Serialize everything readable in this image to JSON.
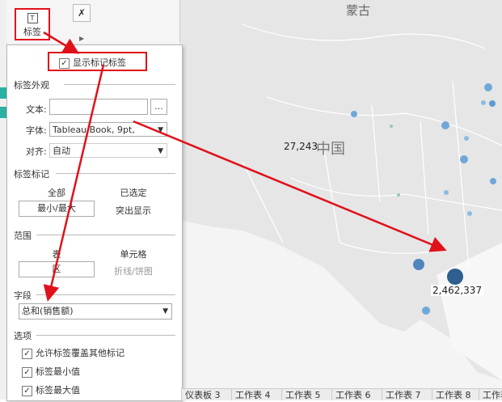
{
  "map": {
    "country_mongolia": "蒙古",
    "country_china": "中国",
    "value_china": "27,243",
    "value_guangdong": "2,462,337",
    "colors": {
      "land": "#e9e9e9",
      "border": "#ffffff",
      "water": "#fbfbfb",
      "dot_light": "#6fa8d8",
      "dot_dark": "#2e5f8e",
      "dot_mid": "#4f85bf",
      "dot_teal": "#8fc9c3"
    }
  },
  "toolbar": {
    "label_button_text": "标签",
    "label_button_icon": "T",
    "clear_icon": "clear-filter-icon"
  },
  "panel": {
    "show_labels": "显示标记标签",
    "appearance_section": "标签外观",
    "text_label": "文本:",
    "text_button": "...",
    "font_label": "字体:",
    "font_value": "Tableau Book,  9pt,",
    "align_label": "对齐:",
    "align_value": "自动",
    "marks_section": "标签标记",
    "marks_all": "全部",
    "marks_selected": "已选定",
    "marks_minmax": "最小/最大",
    "marks_highlight": "突出显示",
    "range_section": "范围",
    "range_table": "表",
    "range_cell": "单元格",
    "range_table_value": "区",
    "range_cell_value": "折线/饼图",
    "field_section": "字段",
    "field_value": "总和(销售额)",
    "options_section": "选项",
    "option1": "允许标签覆盖其他标记",
    "option2": "标签最小值",
    "option3": "标签最大值"
  },
  "tabs": [
    "仪表板 3",
    "工作表 4",
    "工作表 5",
    "工作表 6",
    "工作表 7",
    "工作表 8",
    "工作表"
  ],
  "annotation_color": "#e0111a"
}
